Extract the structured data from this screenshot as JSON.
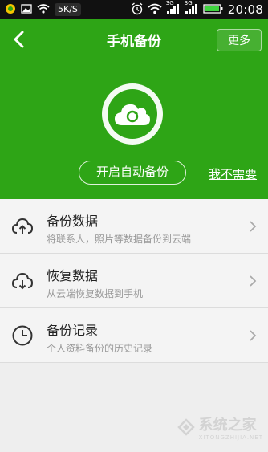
{
  "status_bar": {
    "net_speed": "5K/S",
    "signal_label_1": "3G",
    "signal_label_2": "3G",
    "time": "20:08"
  },
  "header": {
    "title": "手机备份",
    "more_label": "更多",
    "auto_backup_label": "开启自动备份",
    "no_need_label": "我不需要"
  },
  "list": {
    "items": [
      {
        "title": "备份数据",
        "subtitle": "将联系人，照片等数据备份到云端",
        "icon": "cloud-upload-icon"
      },
      {
        "title": "恢复数据",
        "subtitle": "从云端恢复数据到手机",
        "icon": "cloud-download-icon"
      },
      {
        "title": "备份记录",
        "subtitle": "个人资料备份的历史记录",
        "icon": "clock-icon"
      }
    ]
  },
  "watermark": {
    "text": "系统之家",
    "sub": "XITONGZHIJIA.NET"
  },
  "colors": {
    "accent": "#2ea516",
    "background": "#eeeeee"
  }
}
